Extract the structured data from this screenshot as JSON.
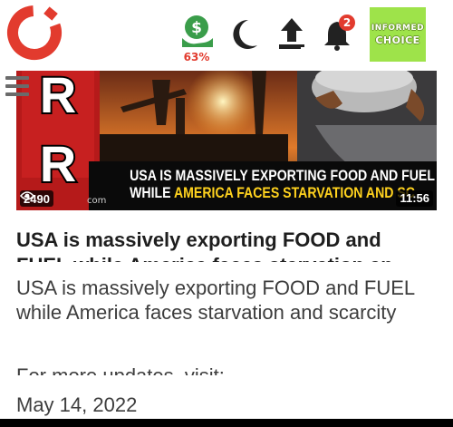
{
  "header": {
    "progress_percent": "63%",
    "notification_count": "2",
    "informed_choice_line1": "INFORMED",
    "informed_choice_line2": "CHOICE"
  },
  "icons": {
    "logo": "c-logo-icon",
    "menu": "hamburger-menu-icon",
    "dollar": "dollar-icon",
    "moon": "moon-icon",
    "upload": "upload-icon",
    "bell": "bell-icon",
    "views": "eye-icon"
  },
  "colors": {
    "brand_red": "#e23b2e",
    "progress_green": "#3a9d4a",
    "informed_choice_bg": "#9ee34a",
    "caption_yellow": "#ffd21e"
  },
  "video": {
    "caption_line1": "USA IS MASSIVELY EXPORTING FOOD AND FUEL",
    "caption_line2_white": "WHILE",
    "caption_line2_yellow": "AMERICA FACES STARVATION AND SC",
    "views": "2490",
    "duration": "11:56",
    "channel_letters": [
      "R",
      "R"
    ],
    "watermark": "com"
  },
  "article": {
    "headline": "USA is massively exporting FOOD and FUEL while America faces starvation an",
    "description": "USA is massively exporting FOOD and FUEL while America faces starvation and scarcity",
    "more_updates": "For more updates, visit:",
    "date": "May 14, 2022"
  }
}
